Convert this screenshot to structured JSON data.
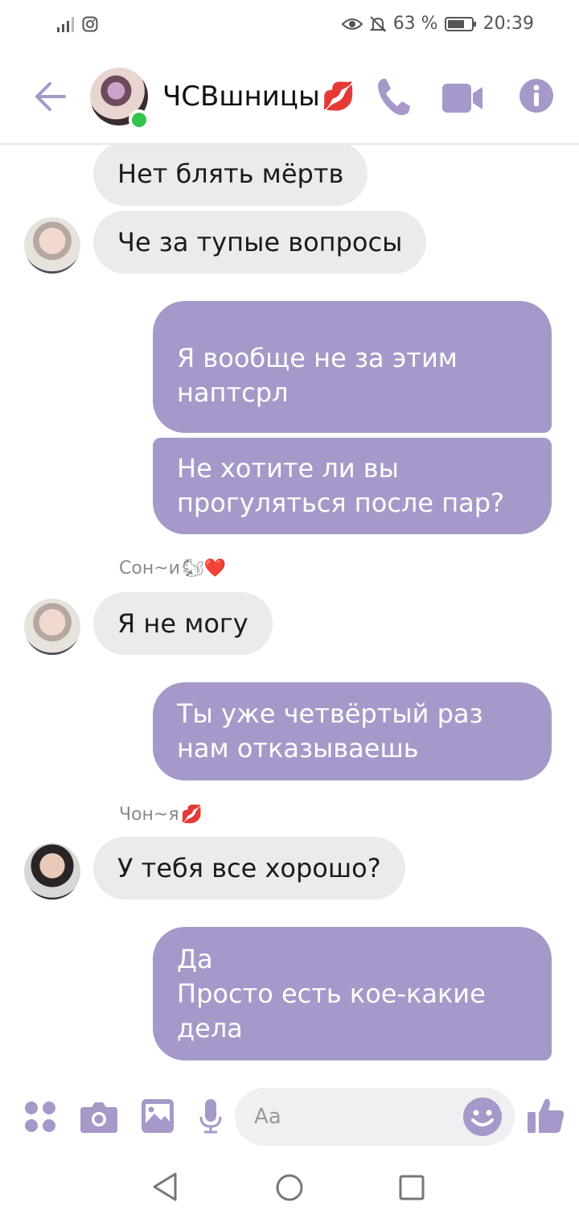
{
  "status_bar": {
    "battery_percent": "63 %",
    "time": "20:39"
  },
  "header": {
    "chat_title": "ЧСВшницы",
    "title_emoji": "💋"
  },
  "messages": [
    {
      "id": "m1",
      "direction": "incoming",
      "text": "Нет блять мёртв"
    },
    {
      "id": "m2",
      "direction": "incoming",
      "text": "Че за тупые вопросы"
    },
    {
      "id": "m3",
      "direction": "outgoing",
      "text": "Я вообще не за этим\nнаптсрл"
    },
    {
      "id": "m4",
      "direction": "outgoing",
      "text": "Не хотите ли вы\nпрогуляться после пар?"
    },
    {
      "id": "m5",
      "direction": "incoming",
      "sender": "Сон~и",
      "sender_emoji": "🐿❤️",
      "text": "Я не могу"
    },
    {
      "id": "m6",
      "direction": "outgoing",
      "text": "Ты уже четвёртый раз\nнам отказываешь"
    },
    {
      "id": "m7",
      "direction": "incoming",
      "sender": "Чон~я",
      "sender_emoji": "💋",
      "text": "У тебя все хорошо?"
    },
    {
      "id": "m8",
      "direction": "outgoing",
      "text": "Да\nПросто есть кое-какие\nдела"
    }
  ],
  "composer": {
    "placeholder": "Aa"
  },
  "colors": {
    "accent": "#a699c9",
    "incoming_bubble": "#ebebed",
    "online": "#35c24b"
  }
}
